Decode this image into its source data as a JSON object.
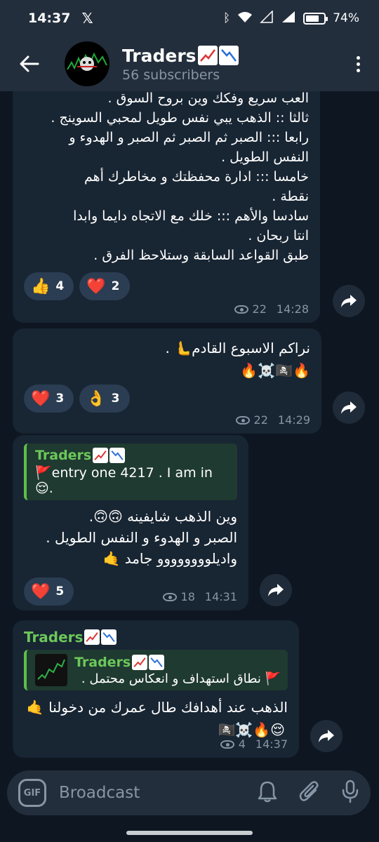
{
  "status": {
    "time": "14:37",
    "x_icon": "x-logo-icon",
    "battery": "74%"
  },
  "header": {
    "title": "Traders",
    "subtitle": "56 subscribers"
  },
  "messages": [
    {
      "lines": [
        "العب سريع وفكك وين بروح السوق .",
        "ثالثا :: الذهب يبي نفس طويل لمحبي السوينج .",
        "رابعا ::: الصبر ثم الصبر ثم الصبر و الهدوء و",
        "النفس الطويل .",
        "خامسا ::: ادارة محفظتك و مخاطرك أهم",
        "نقطة .",
        "سادسا والأهم ::: خلك مع الاتجاه دايما وابدا",
        "انتا ربحان .",
        "طبق القواعد السابقة وستلاحظ الفرق ."
      ],
      "reactions": [
        {
          "emoji": "👍",
          "count": "4"
        },
        {
          "emoji": "❤️",
          "count": "2"
        }
      ],
      "views": "22",
      "time": "14:28"
    },
    {
      "lines": [
        "نراكم الاسبوع القادم🫷 .",
        "🔥🏴‍☠️☠️🔥"
      ],
      "reactions": [
        {
          "emoji": "❤️",
          "count": "3"
        },
        {
          "emoji": "👌",
          "count": "3"
        }
      ],
      "views": "22",
      "time": "14:29"
    },
    {
      "quote_name": "Traders",
      "quote_text": "🚩entry one 4217 . I am in 😌.",
      "lines": [
        "وين الذهب شايفينه 🙃🙃.",
        "الصبر و الهدوء و النفس الطويل .",
        "واديلوووووووو جامد 🤙"
      ],
      "reactions": [
        {
          "emoji": "❤️",
          "count": "5"
        }
      ],
      "views": "18",
      "time": "14:31"
    },
    {
      "sender": "Traders",
      "quote_name": "Traders",
      "quote_text": "🚩 نطاق استهداف و انعكاس محتمل .",
      "lines": [
        "الذهب عند أهدافك طال عمرك من دخولنا 🤙",
        "😌🔥☠️🏴‍☠️"
      ],
      "views": "4",
      "time": "14:37"
    }
  ],
  "input": {
    "placeholder": "Broadcast",
    "gif_label": "GIF"
  }
}
